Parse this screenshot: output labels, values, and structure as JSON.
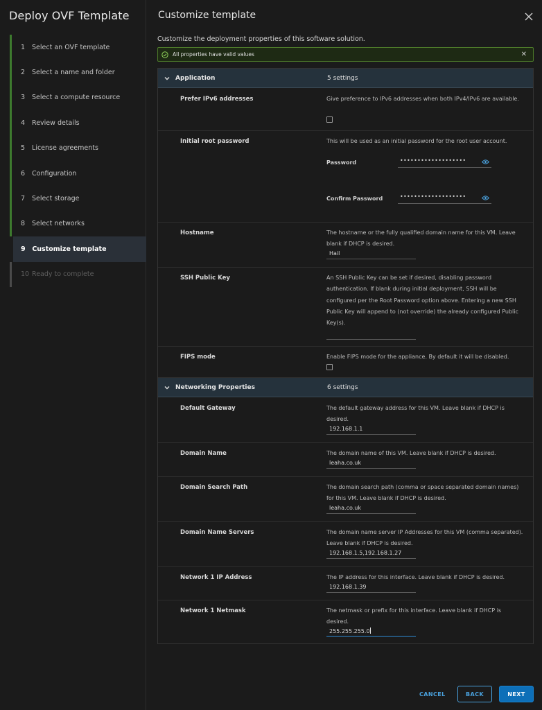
{
  "wizard": {
    "title": "Deploy OVF Template",
    "steps": [
      {
        "num": "1",
        "label": "Select an OVF template"
      },
      {
        "num": "2",
        "label": "Select a name and folder"
      },
      {
        "num": "3",
        "label": "Select a compute resource"
      },
      {
        "num": "4",
        "label": "Review details"
      },
      {
        "num": "5",
        "label": "License agreements"
      },
      {
        "num": "6",
        "label": "Configuration"
      },
      {
        "num": "7",
        "label": "Select storage"
      },
      {
        "num": "8",
        "label": "Select networks"
      },
      {
        "num": "9",
        "label": "Customize template"
      },
      {
        "num": "10",
        "label": "Ready to complete"
      }
    ],
    "active_step": "9"
  },
  "panel": {
    "title": "Customize template",
    "subtitle": "Customize the deployment properties of this software solution.",
    "alert": "All properties have valid values"
  },
  "groups": {
    "application": {
      "label": "Application",
      "count": "5 settings",
      "prefer_ipv6": {
        "label": "Prefer IPv6 addresses",
        "desc": "Give preference to IPv6 addresses when both IPv4/IPv6 are available.",
        "checked": false
      },
      "root_password": {
        "label": "Initial root password",
        "desc": "This will be used as an initial password for the root user account.",
        "password_label": "Password",
        "password_value": "•••••••••••••••••••",
        "confirm_label": "Confirm Password",
        "confirm_value": "•••••••••••••••••••"
      },
      "hostname": {
        "label": "Hostname",
        "desc": "The hostname or the fully qualified domain name for this VM. Leave blank if DHCP is desired.",
        "value": "Hail"
      },
      "ssh_key": {
        "label": "SSH Public Key",
        "desc": "An SSH Public Key can be set if desired, disabling password authentication. If blank during initial deployment, SSH will be configured per the Root Password option above. Entering a new SSH Public Key will append to (not override) the already configured Public Key(s).",
        "value": ""
      },
      "fips": {
        "label": "FIPS mode",
        "desc": "Enable FIPS mode for the appliance. By default it will be disabled.",
        "checked": false
      }
    },
    "networking": {
      "label": "Networking Properties",
      "count": "6 settings",
      "gateway": {
        "label": "Default Gateway",
        "desc": "The default gateway address for this VM. Leave blank if DHCP is desired.",
        "value": "192.168.1.1"
      },
      "domain_name": {
        "label": "Domain Name",
        "desc": "The domain name of this VM. Leave blank if DHCP is desired.",
        "value": "leaha.co.uk"
      },
      "search_path": {
        "label": "Domain Search Path",
        "desc": "The domain search path (comma or space separated domain names) for this VM. Leave blank if DHCP is desired.",
        "value": "leaha.co.uk"
      },
      "dns": {
        "label": "Domain Name Servers",
        "desc": "The domain name server IP Addresses for this VM (comma separated). Leave blank if DHCP is desired.",
        "value": "192.168.1.5,192.168.1.27"
      },
      "ip": {
        "label": "Network 1 IP Address",
        "desc": "The IP address for this interface. Leave blank if DHCP is desired.",
        "value": "192.168.1.39"
      },
      "netmask": {
        "label": "Network 1 Netmask",
        "desc": "The netmask or prefix for this interface. Leave blank if DHCP is desired.",
        "value": "255.255.255.0"
      }
    }
  },
  "footer": {
    "cancel": "CANCEL",
    "back": "BACK",
    "next": "NEXT"
  },
  "colors": {
    "accent": "#4aa3e0",
    "primary_button": "#0d6fb8",
    "success": "#4d7a2a",
    "group_header": "#25323c"
  }
}
